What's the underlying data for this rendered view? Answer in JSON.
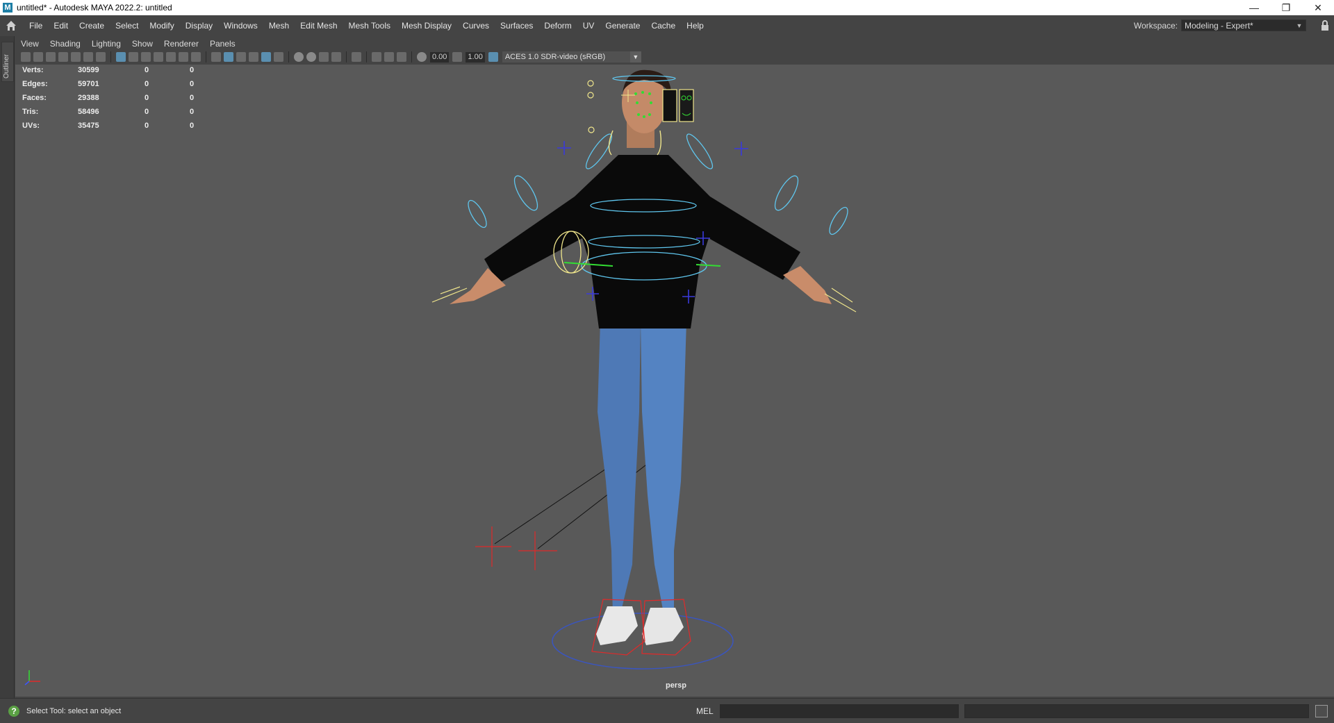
{
  "window": {
    "title": "untitled* - Autodesk MAYA 2022.2: untitled",
    "app_icon": "M"
  },
  "menubar": {
    "items": [
      "File",
      "Edit",
      "Create",
      "Select",
      "Modify",
      "Display",
      "Windows",
      "Mesh",
      "Edit Mesh",
      "Mesh Tools",
      "Mesh Display",
      "Curves",
      "Surfaces",
      "Deform",
      "UV",
      "Generate",
      "Cache",
      "Help"
    ],
    "workspace_label": "Workspace:",
    "workspace_value": "Modeling - Expert*"
  },
  "outliner_tab": "Outliner",
  "panel_menu": [
    "View",
    "Shading",
    "Lighting",
    "Show",
    "Renderer",
    "Panels"
  ],
  "panel_toolbar": {
    "exposure": "0.00",
    "gamma": "1.00",
    "color_space": "ACES 1.0 SDR-video (sRGB)"
  },
  "hud": {
    "rows": [
      {
        "label": "Verts:",
        "total": "30599",
        "selected": "0",
        "uv_selected": "0"
      },
      {
        "label": "Edges:",
        "total": "59701",
        "selected": "0",
        "uv_selected": "0"
      },
      {
        "label": "Faces:",
        "total": "29388",
        "selected": "0",
        "uv_selected": "0"
      },
      {
        "label": "Tris:",
        "total": "58496",
        "selected": "0",
        "uv_selected": "0"
      },
      {
        "label": "UVs:",
        "total": "35475",
        "selected": "0",
        "uv_selected": "0"
      }
    ]
  },
  "viewport": {
    "camera": "persp",
    "background": "#595959"
  },
  "statusbar": {
    "help_text": "Select Tool: select an object",
    "command_language": "MEL",
    "command_value": ""
  },
  "colors": {
    "rig_cyan": "#5fc6ee",
    "rig_yellow": "#f0e68c",
    "rig_green": "#33dd33",
    "rig_blue": "#3a3adb",
    "ik_red": "#e02a2a"
  },
  "icons": [
    "maya-app-icon",
    "home-icon",
    "minimize-icon",
    "restore-icon",
    "close-icon",
    "lock-icon",
    "help-icon",
    "script-editor-icon"
  ]
}
